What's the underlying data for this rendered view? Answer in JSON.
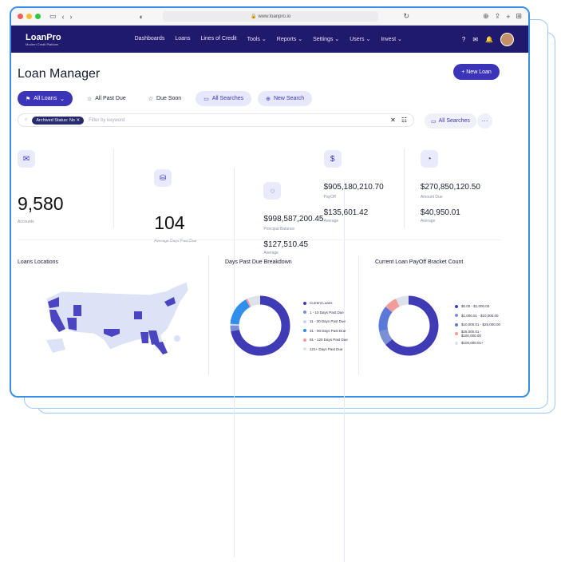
{
  "browser": {
    "url": "www.loanpro.io"
  },
  "brand": {
    "name": "LoanPro",
    "tagline": "Modern Credit Platform",
    "nav_color": "#1f1a6b",
    "accent": "#3b34b8"
  },
  "nav": {
    "items": [
      "Dashboards",
      "Loans",
      "Lines of Credit",
      "Tools",
      "Reports",
      "Settings",
      "Users",
      "Invest"
    ],
    "dropdown_items": [
      "Tools",
      "Reports",
      "Settings",
      "Users",
      "Invest"
    ]
  },
  "page": {
    "title": "Loan Manager",
    "new_loan": "New Loan"
  },
  "tabs": {
    "all_loans": "All Loans",
    "all_past_due": "All Past Due",
    "due_soon": "Due Soon",
    "all_searches": "All Searches",
    "new_search": "New Search"
  },
  "search": {
    "chip": "Archived Status: No",
    "placeholder": "Filter by keyword",
    "all_searches": "All Searches"
  },
  "stats": {
    "accounts": {
      "value": "9,580",
      "label": "Accounts"
    },
    "avg_days": {
      "value": "104",
      "label": "Average Days Past Due"
    },
    "principal": {
      "value": "$998,587,200.45",
      "label": "Principal Balance",
      "avg": "$127,510.45",
      "avg_label": "Average"
    },
    "payoff": {
      "value": "$905,180,210.70",
      "label": "PayOff",
      "avg": "$135,601.42",
      "avg_label": "Average"
    },
    "amount_due": {
      "value": "$270,850,120.50",
      "label": "Amount Due",
      "avg": "$40,950.01",
      "avg_label": "Average"
    }
  },
  "panels": {
    "map_title": "Loans Locations",
    "dpd_title": "Days Past Due Breakdown",
    "payoff_title": "Current Loan PayOff Bracket Count"
  },
  "chart_data": [
    {
      "type": "pie",
      "title": "Days Past Due Breakdown",
      "categories": [
        "Current Loans",
        "1 - 10 Days Past Due",
        "11 - 30 Days Past Due",
        "31 - 90 Days Past Due",
        "91 - 120 Days Past Due",
        "121+ Days Past Due"
      ],
      "values": [
        72,
        3,
        1,
        16,
        1,
        7
      ],
      "colors": [
        "#3f3bb5",
        "#7a8fd6",
        "#c9d3ef",
        "#2f8fea",
        "#f29b9b",
        "#dde2ea"
      ]
    },
    {
      "type": "pie",
      "title": "Current Loan PayOff Bracket Count",
      "categories": [
        "$0.00 - $1,000.00",
        "$1,000.01 - $10,000.00",
        "$10,000.01 - $25,000.00",
        "$25,000.01 - $100,000.00",
        "$100,000.01+"
      ],
      "values": [
        64,
        8,
        14,
        7,
        7
      ],
      "colors": [
        "#3f3bb5",
        "#7a8fd6",
        "#5a79d8",
        "#f29b9b",
        "#dde2ea"
      ]
    }
  ]
}
